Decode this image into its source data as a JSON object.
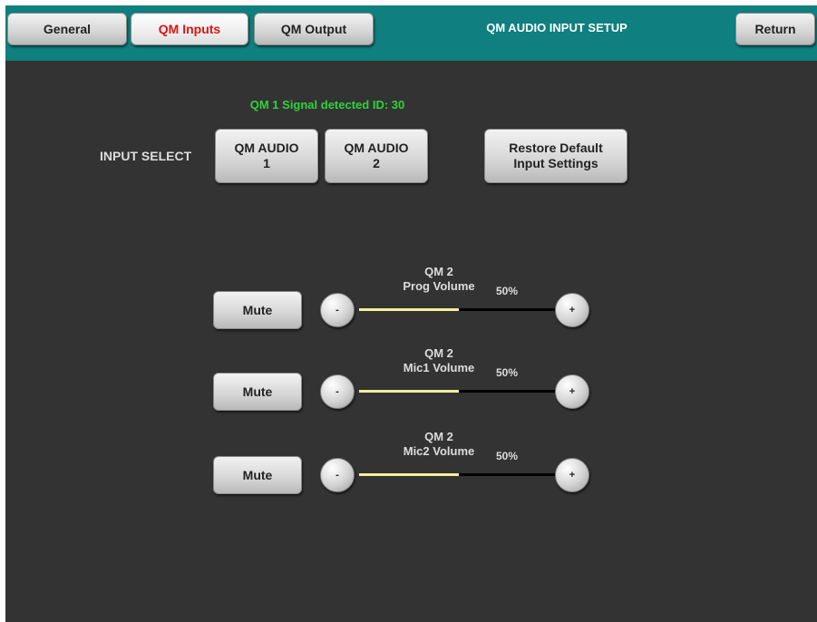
{
  "header": {
    "tabs": [
      {
        "label": "General"
      },
      {
        "label": "QM Inputs"
      },
      {
        "label": "QM Output"
      }
    ],
    "title": "QM AUDIO INPUT SETUP",
    "return_label": "Return"
  },
  "signal": {
    "status_text": "QM 1 Signal detected ID: 30",
    "status_color": "#2fd33a"
  },
  "input_select": {
    "label": "INPUT SELECT",
    "options": [
      {
        "line1": "QM AUDIO",
        "line2": "1"
      },
      {
        "line1": "QM AUDIO",
        "line2": "2"
      }
    ],
    "restore": {
      "line1": "Restore Default",
      "line2": "Input Settings"
    }
  },
  "volumes": [
    {
      "title_line1": "QM 2",
      "title_line2": "Prog Volume",
      "percent_text": "50%",
      "level": 0.5,
      "mute_label": "Mute",
      "minus_label": "-",
      "plus_label": "+"
    },
    {
      "title_line1": "QM 2",
      "title_line2": "Mic1 Volume",
      "percent_text": "50%",
      "level": 0.5,
      "mute_label": "Mute",
      "minus_label": "-",
      "plus_label": "+"
    },
    {
      "title_line1": "QM 2",
      "title_line2": "Mic2 Volume",
      "percent_text": "50%",
      "level": 0.5,
      "mute_label": "Mute",
      "minus_label": "-",
      "plus_label": "+"
    }
  ],
  "colors": {
    "header_bg": "#0f7f7f",
    "panel_bg": "#333333",
    "active_tab_text": "#e01212",
    "slider_fill": "#f2ef9c"
  }
}
